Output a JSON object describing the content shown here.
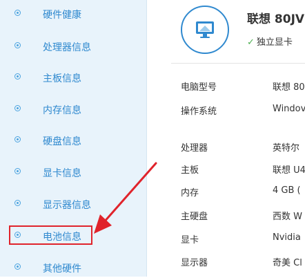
{
  "sidebar": {
    "items": [
      {
        "label": "硬件健康"
      },
      {
        "label": "处理器信息"
      },
      {
        "label": "主板信息"
      },
      {
        "label": "内存信息"
      },
      {
        "label": "硬盘信息"
      },
      {
        "label": "显卡信息"
      },
      {
        "label": "显示器信息"
      },
      {
        "label": "电池信息"
      },
      {
        "label": "其他硬件"
      }
    ]
  },
  "header": {
    "title": "联想 80JV",
    "badge": "独立显卡",
    "icon": "monitor-icon"
  },
  "details": {
    "group1": [
      {
        "label": "电脑型号",
        "value": "联想 80"
      },
      {
        "label": "操作系统",
        "value": "Windov"
      }
    ],
    "group2": [
      {
        "label": "处理器",
        "value": "英特尔"
      },
      {
        "label": "主板",
        "value": "联想 U4"
      },
      {
        "label": "内存",
        "value": "4 GB ("
      },
      {
        "label": "主硬盘",
        "value": "西数 W"
      },
      {
        "label": "显卡",
        "value": "Nvidia"
      },
      {
        "label": "显示器",
        "value": "奇美 Cl"
      }
    ]
  },
  "colors": {
    "accent": "#2f89cf",
    "sidebar_bg": "#e8f3fb",
    "annotation": "#e0232b",
    "check": "#4caf50"
  }
}
